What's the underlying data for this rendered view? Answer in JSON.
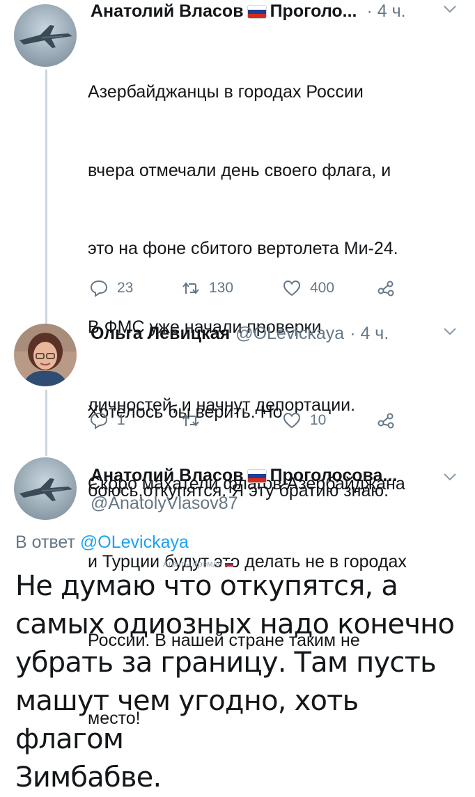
{
  "colors": {
    "text": "#14171a",
    "muted": "#657786",
    "link": "#1da1f2",
    "thread_line": "#ccd6dd",
    "flag_white": "#ffffff",
    "flag_blue": "#1c3f94",
    "flag_red": "#d52b1e"
  },
  "tweet1": {
    "author": "Анатолий Власов",
    "author_suffix": "Проголо...",
    "time": "· 4 ч.",
    "avatar_icon": "jet-fighter-avatar",
    "lines": [
      "Азербайджанцы в городах России",
      "вчера отмечали день своего флага, и",
      "это на фоне сбитого вертолета Ми-24.",
      "В ФМС уже начали проверки",
      "личностей, и начнут депортации.",
      "Скоро махатели флагов Азербайджана",
      "и Турции будут это делать не в городах",
      "России. В нашей стране таким не",
      "место!"
    ],
    "reply_count": "23",
    "retweet_count": "130",
    "like_count": "400"
  },
  "tweet2": {
    "author": "Ольга Левицкая",
    "handle": "@OLevickaya",
    "time": "· 4 ч.",
    "avatar_icon": "woman-portrait-avatar",
    "lines": [
      "Хотелось бы верить. Но",
      "боюсь,откупятся. Я эту братию знаю."
    ],
    "reply_count": "1",
    "retweet_count": "",
    "like_count": "10"
  },
  "tweet3": {
    "author": "Анатолий Власов",
    "author_suffix": "Проголосова...",
    "handle": "@AnatolyVlasov87",
    "avatar_icon": "jet-fighter-avatar",
    "reply_prefix": "В ответ",
    "reply_handle": "@OLevickaya",
    "watermark": "Агенты Кремля",
    "lines": [
      "Не думаю что откупятся, а",
      "самых одиозных надо конечно",
      "убрать за границу. Там пусть",
      "машут чем угодно, хоть флагом",
      "Зимбабве."
    ]
  },
  "icons": {
    "reply": "reply-icon",
    "retweet": "retweet-icon",
    "like": "heart-icon",
    "share": "share-icon",
    "more": "chevron-down-icon"
  }
}
